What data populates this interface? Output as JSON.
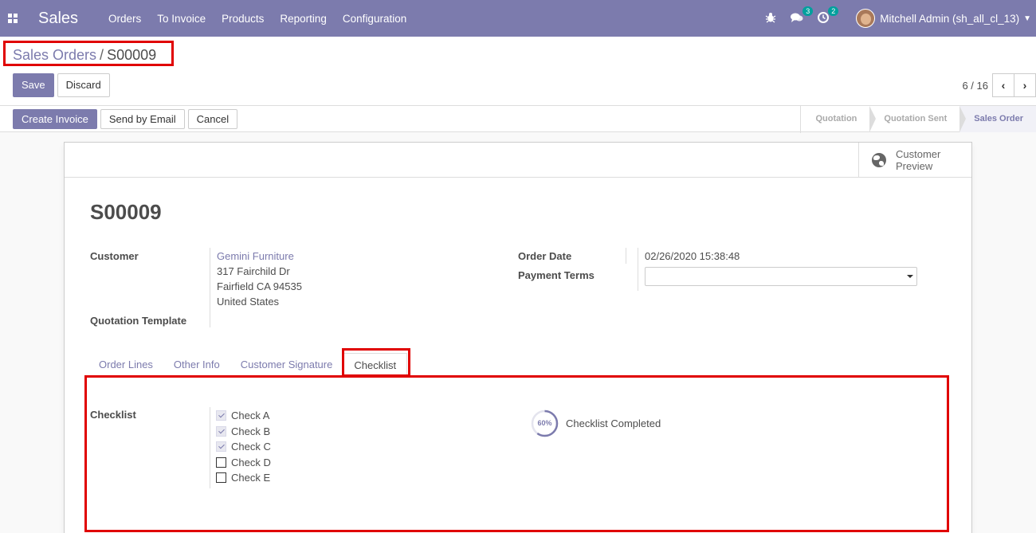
{
  "navbar": {
    "brand": "Sales",
    "menu": [
      "Orders",
      "To Invoice",
      "Products",
      "Reporting",
      "Configuration"
    ],
    "chat_count": "3",
    "activity_count": "2",
    "user": "Mitchell Admin (sh_all_cl_13)"
  },
  "breadcrumb": {
    "parent": "Sales Orders",
    "separator": "/",
    "current": "S00009"
  },
  "buttons": {
    "save": "Save",
    "discard": "Discard",
    "create_invoice": "Create Invoice",
    "send_email": "Send by Email",
    "cancel": "Cancel"
  },
  "pager": {
    "value": "6 / 16"
  },
  "stages": [
    "Quotation",
    "Quotation Sent",
    "Sales Order"
  ],
  "active_stage": "Sales Order",
  "customer_preview": [
    "Customer",
    "Preview"
  ],
  "form": {
    "title": "S00009",
    "customer_label": "Customer",
    "customer_name": "Gemini Furniture",
    "address": [
      "317 Fairchild Dr",
      "Fairfield CA 94535",
      "United States"
    ],
    "quotation_template_label": "Quotation Template",
    "order_date_label": "Order Date",
    "order_date": "02/26/2020 15:38:48",
    "payment_terms_label": "Payment Terms",
    "payment_terms": ""
  },
  "tabs": [
    "Order Lines",
    "Other Info",
    "Customer Signature",
    "Checklist"
  ],
  "active_tab": "Checklist",
  "checklist": {
    "label": "Checklist",
    "items": [
      {
        "label": "Check A",
        "checked": true
      },
      {
        "label": "Check B",
        "checked": true
      },
      {
        "label": "Check C",
        "checked": true
      },
      {
        "label": "Check D",
        "checked": false
      },
      {
        "label": "Check E",
        "checked": false
      }
    ],
    "progress_percent": 60,
    "progress_text": "60%",
    "progress_label": "Checklist Completed"
  },
  "colors": {
    "primary": "#7c7bad",
    "highlight": "#e00000",
    "badge": "#00a09d"
  }
}
